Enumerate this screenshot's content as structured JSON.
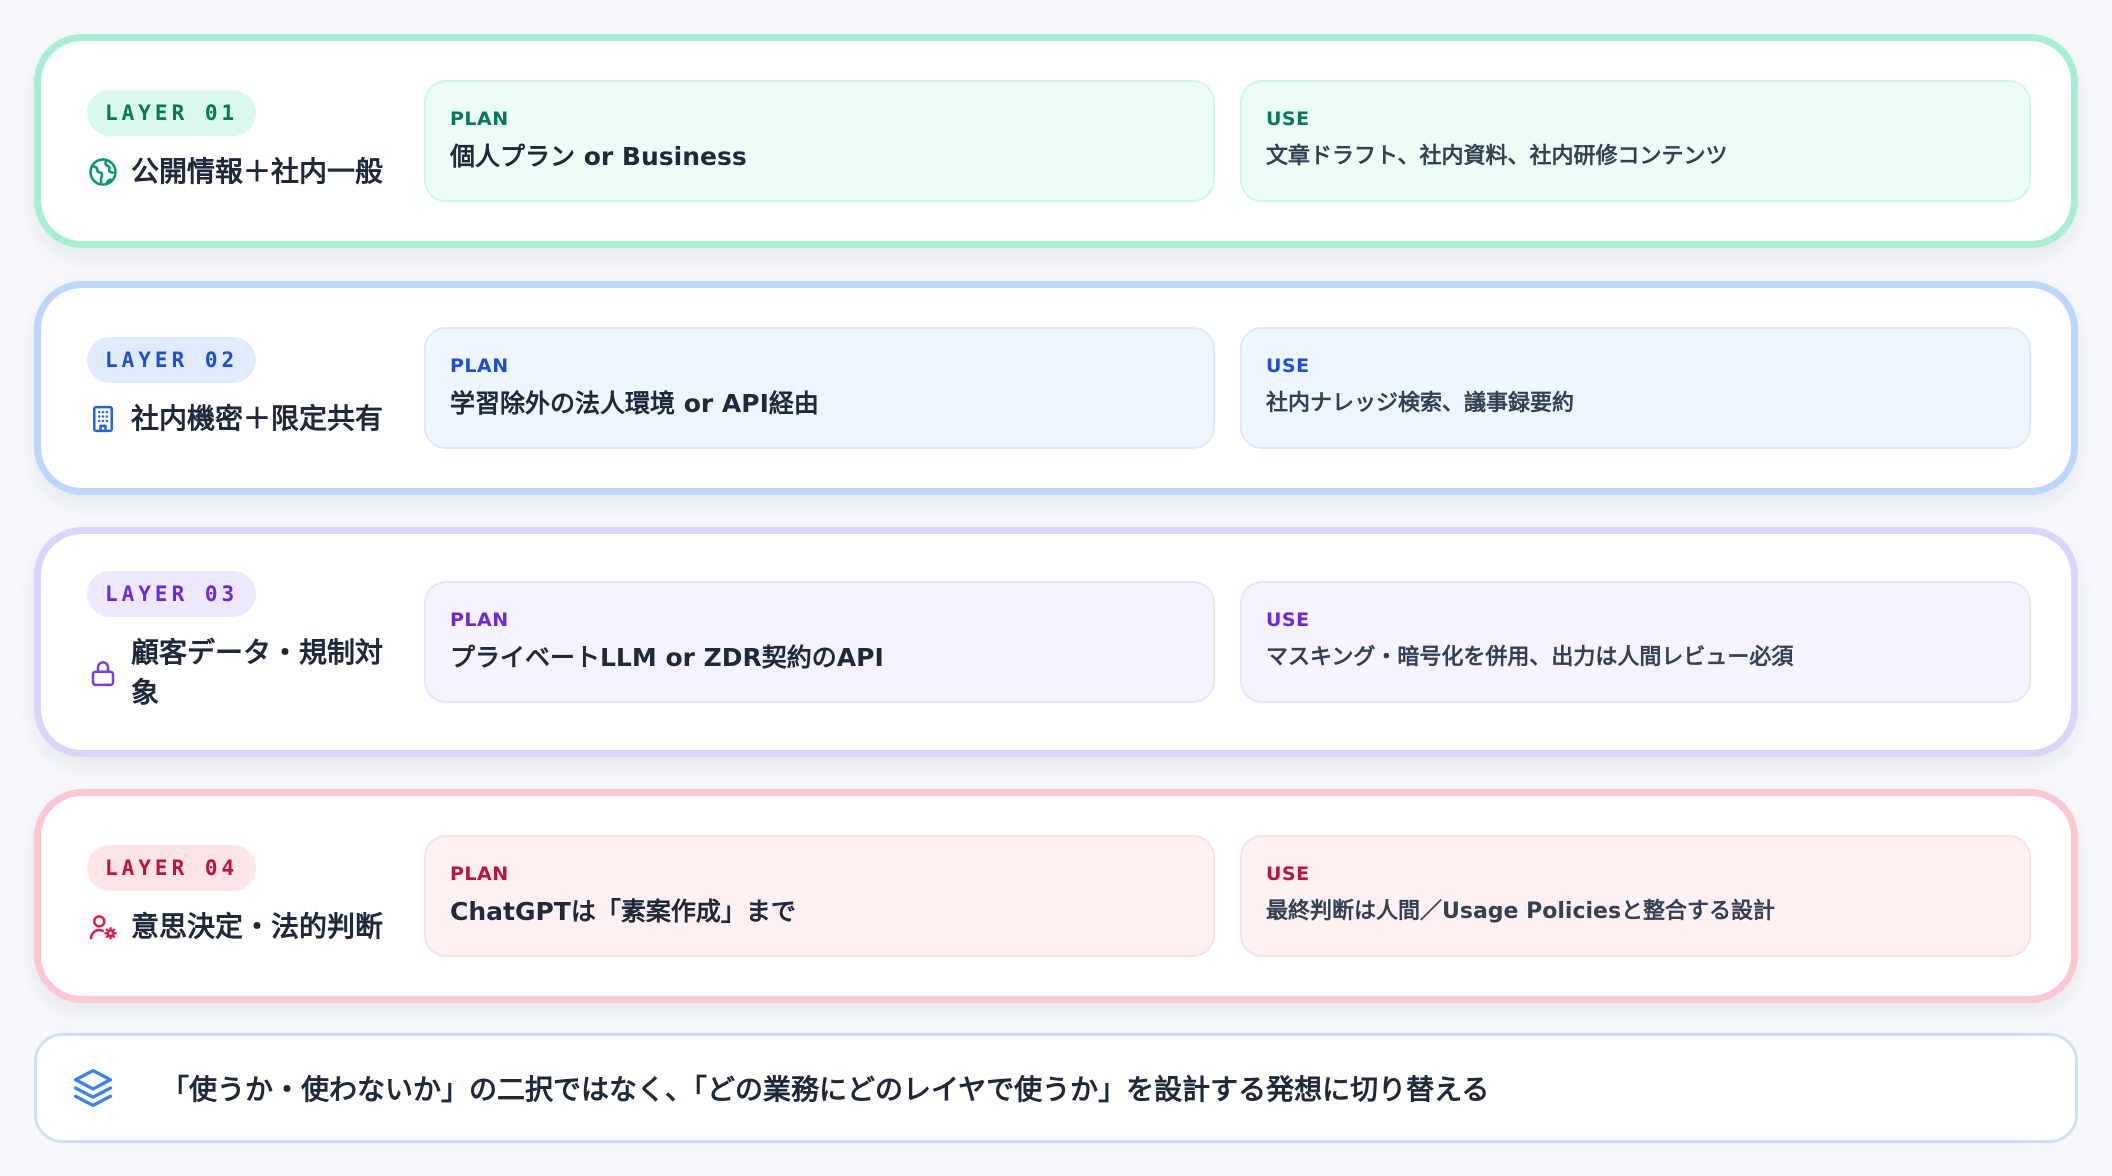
{
  "colors": {
    "layer1": "#059669",
    "layer2": "#2563eb",
    "layer3": "#7c3aed",
    "layer4": "#e11d48",
    "footer_icon": "#3b82f6"
  },
  "layers": [
    {
      "badge": "LAYER 01",
      "title": "公開情報＋社内一般",
      "icon": "globe-icon",
      "plan_label": "PLAN",
      "plan": "個人プラン or Business",
      "use_label": "USE",
      "use": "文章ドラフト、社内資料、社内研修コンテンツ"
    },
    {
      "badge": "LAYER 02",
      "title": "社内機密＋限定共有",
      "icon": "building-icon",
      "plan_label": "PLAN",
      "plan": "学習除外の法人環境 or API経由",
      "use_label": "USE",
      "use": "社内ナレッジ検索、議事録要約"
    },
    {
      "badge": "LAYER 03",
      "title": "顧客データ・規制対象",
      "icon": "lock-icon",
      "plan_label": "PLAN",
      "plan": "プライベートLLM or ZDR契約のAPI",
      "use_label": "USE",
      "use": "マスキング・暗号化を併用、出力は人間レビュー必須"
    },
    {
      "badge": "LAYER 04",
      "title": "意思決定・法的判断",
      "icon": "user-gear-icon",
      "plan_label": "PLAN",
      "plan": "ChatGPTは「素案作成」まで",
      "use_label": "USE",
      "use": "最終判断は人間／Usage Policiesと整合する設計"
    }
  ],
  "footer": {
    "icon": "layers-icon",
    "text": "「使うか・使わないか」の二択ではなく、「どの業務にどのレイヤで使うか」を設計する発想に切り替える"
  }
}
